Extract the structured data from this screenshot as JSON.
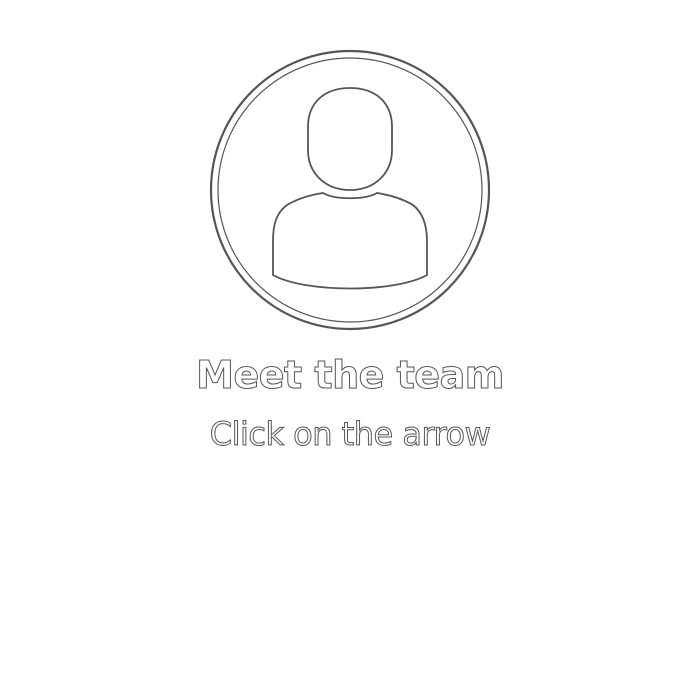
{
  "card": {
    "title": "Meet the team",
    "subtitle": "Click on the arrow",
    "icon": "user-avatar-icon"
  },
  "colors": {
    "background": "#ffffff",
    "fill": "#ffffff",
    "outline": "#555555"
  }
}
